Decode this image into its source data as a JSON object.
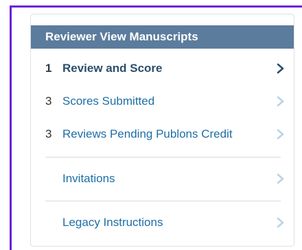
{
  "header": {
    "title": "Reviewer View Manuscripts"
  },
  "items": [
    {
      "count": "1",
      "label": "Review and Score",
      "chevron_color": "#2b4f6b"
    },
    {
      "count": "3",
      "label": "Scores Submitted",
      "chevron_color": "#b9d3e5"
    },
    {
      "count": "3",
      "label": "Reviews Pending Publons Credit",
      "chevron_color": "#b9d3e5"
    },
    {
      "count": "",
      "label": "Invitations",
      "chevron_color": "#b9d3e5"
    },
    {
      "count": "",
      "label": "Legacy Instructions",
      "chevron_color": "#b9d3e5"
    }
  ],
  "colors": {
    "header_bg": "#5c7c9d",
    "link": "#1d6ea6",
    "frame_accent": "#6a1bd8"
  }
}
